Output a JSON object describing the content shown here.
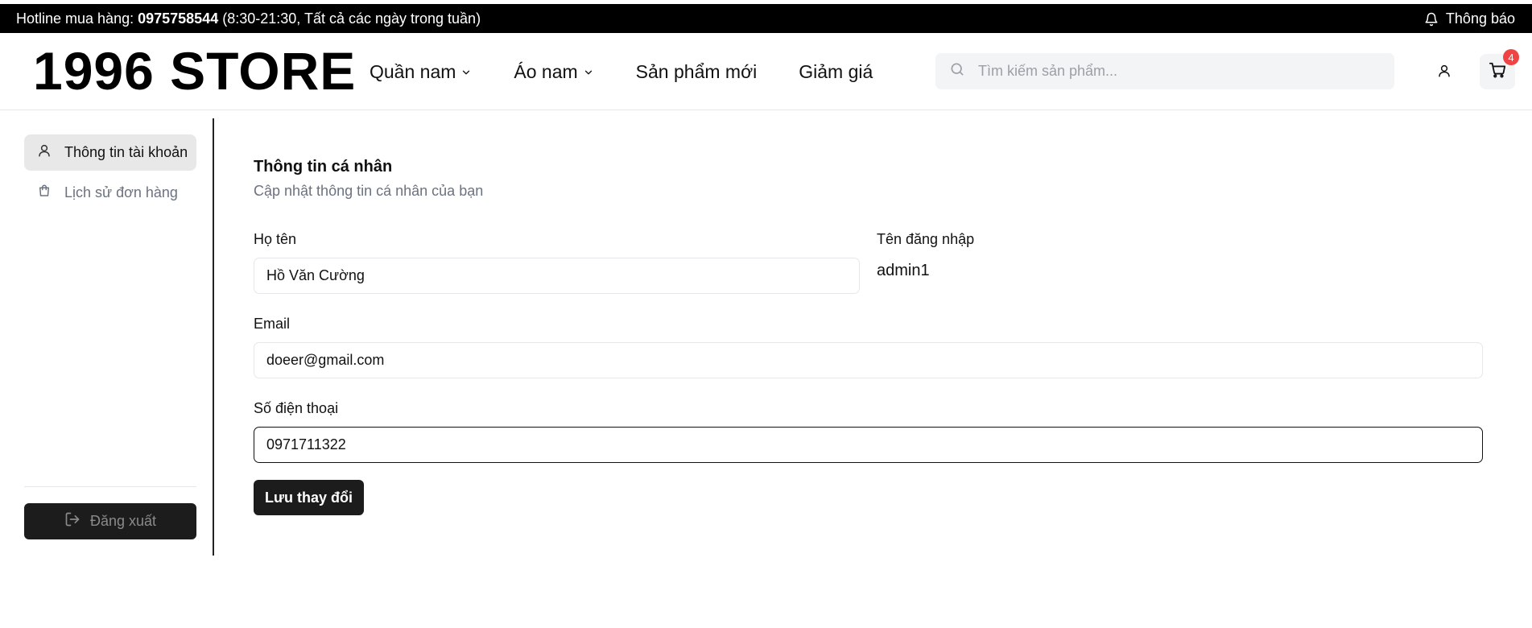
{
  "topbar": {
    "hotline_prefix": "Hotline mua hàng: ",
    "hotline_number": "0975758544",
    "hotline_suffix": " (8:30-21:30, Tất cả các ngày trong tuần)",
    "notification_label": "Thông báo"
  },
  "header": {
    "logo": "1996 STORE",
    "nav": [
      {
        "label": "Quần nam",
        "has_dropdown": true
      },
      {
        "label": "Áo nam",
        "has_dropdown": true
      },
      {
        "label": "Sản phẩm mới",
        "has_dropdown": false
      },
      {
        "label": "Giảm giá",
        "has_dropdown": false
      }
    ],
    "search": {
      "placeholder": "Tìm kiếm sản phẩm..."
    },
    "cart_count": "4"
  },
  "sidebar": {
    "items": [
      {
        "label": "Thông tin tài khoản",
        "icon": "user-icon",
        "active": true
      },
      {
        "label": "Lịch sử đơn hàng",
        "icon": "shopping-bag-icon",
        "active": false
      }
    ],
    "logout_label": "Đăng xuất"
  },
  "profile": {
    "title": "Thông tin cá nhân",
    "subtitle": "Cập nhật thông tin cá nhân của bạn",
    "fullname_label": "Họ tên",
    "fullname_value": "Hồ Văn Cường",
    "username_label": "Tên đăng nhập",
    "username_value": "admin1",
    "email_label": "Email",
    "email_value": "doeer@gmail.com",
    "phone_label": "Số điện thoại",
    "phone_value": "0971711322",
    "save_label": "Lưu thay đổi"
  },
  "colors": {
    "topbar_bg": "#000000",
    "primary_button": "#1c1c1c",
    "badge": "#ef4444",
    "active_sidebar_bg": "#e8e8e8"
  }
}
